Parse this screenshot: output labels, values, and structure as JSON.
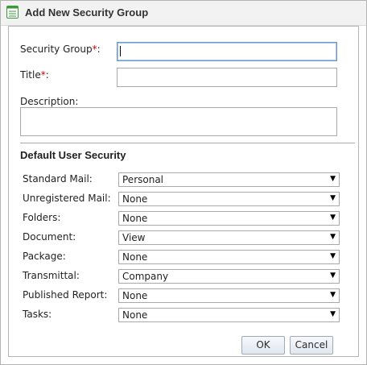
{
  "dialog": {
    "title": "Add New Security Group",
    "icon": "form-list-icon"
  },
  "form": {
    "security_group": {
      "label": "Security Group",
      "required_mark": "*",
      "suffix": ":",
      "value": ""
    },
    "title": {
      "label": "Title",
      "required_mark": "*",
      "suffix": ":",
      "value": ""
    },
    "description": {
      "label": "Description:",
      "value": ""
    }
  },
  "default_security": {
    "heading": "Default User Security",
    "rows": [
      {
        "label": "Standard Mail:",
        "value": "Personal"
      },
      {
        "label": "Unregistered Mail:",
        "value": "None"
      },
      {
        "label": "Folders:",
        "value": "None"
      },
      {
        "label": "Document:",
        "value": "View"
      },
      {
        "label": "Package:",
        "value": "None"
      },
      {
        "label": "Transmittal:",
        "value": "Company"
      },
      {
        "label": "Published Report:",
        "value": "None"
      },
      {
        "label": "Tasks:",
        "value": "None"
      }
    ],
    "dropdown_glyph": "▼"
  },
  "buttons": {
    "ok": "OK",
    "cancel": "Cancel"
  },
  "colors": {
    "required": "#d40000",
    "focus_border": "#6d96c9",
    "icon_green": "#3a9a3a"
  }
}
